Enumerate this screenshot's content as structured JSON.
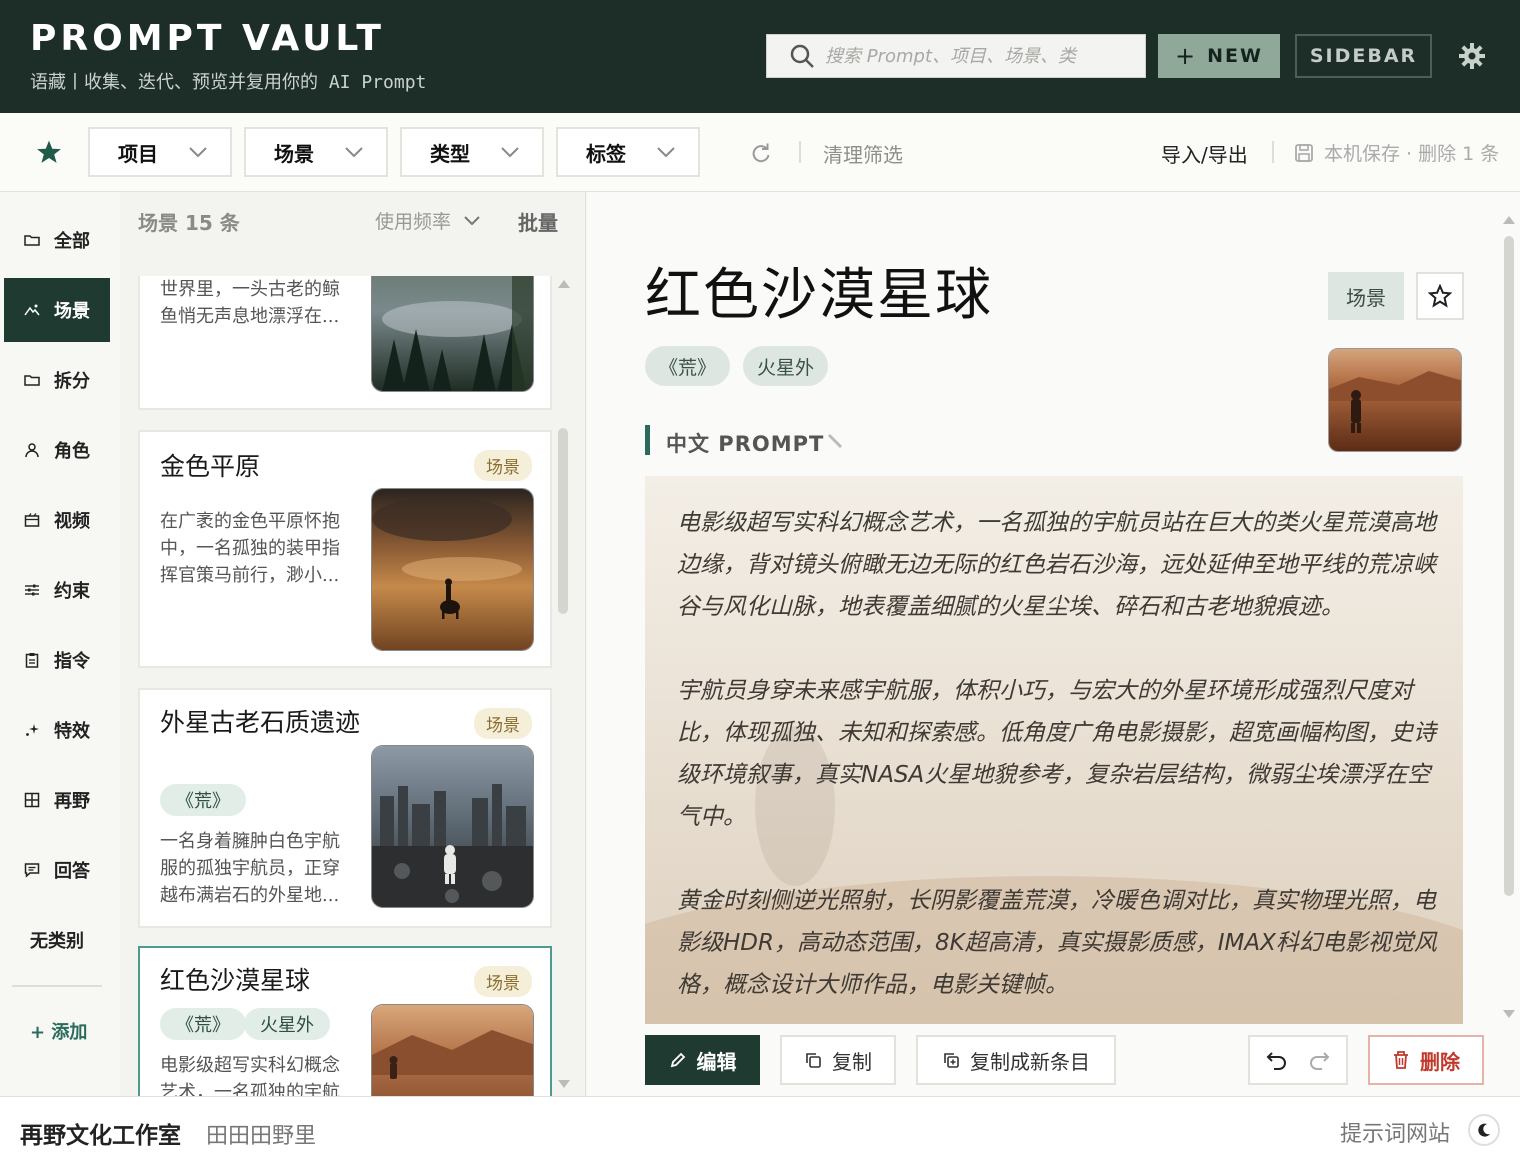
{
  "header": {
    "brand": "PROMPT VAULT",
    "tagline": "语藏丨收集、迭代、预览并复用你的 AI Prompt",
    "search_placeholder": "搜索 Prompt、项目、场景、类",
    "new_label": "NEW",
    "sidebar_label": "SIDEBAR"
  },
  "filters": {
    "dropdowns": [
      "项目",
      "场景",
      "类型",
      "标签"
    ],
    "clear": "清理筛选",
    "import_export": "导入/导出",
    "save_status": "本机保存 · 删除 1 条"
  },
  "nav": {
    "items": [
      {
        "label": "全部",
        "icon": "folder-icon"
      },
      {
        "label": "场景",
        "icon": "landscape-icon"
      },
      {
        "label": "拆分",
        "icon": "folder-icon"
      },
      {
        "label": "角色",
        "icon": "person-icon"
      },
      {
        "label": "视频",
        "icon": "video-icon"
      },
      {
        "label": "约束",
        "icon": "sliders-icon"
      },
      {
        "label": "指令",
        "icon": "clipboard-icon"
      },
      {
        "label": "特效",
        "icon": "sparkle-icon"
      },
      {
        "label": "再野",
        "icon": "grid-icon"
      },
      {
        "label": "回答",
        "icon": "message-icon"
      },
      {
        "label": "无类别",
        "icon": ""
      }
    ],
    "add": "+ 添加",
    "active_index": 1
  },
  "list": {
    "title": "场景 15 条",
    "sort": "使用频率",
    "batch": "批量",
    "cards": [
      {
        "title": "",
        "badge": "",
        "tags": [],
        "desc": "世界里，一头古老的鲸鱼悄无声息地漂浮在..."
      },
      {
        "title": "金色平原",
        "badge": "场景",
        "tags": [],
        "desc": "在广袤的金色平原怀抱中，一名孤独的装甲指挥官策马前行，渺小..."
      },
      {
        "title": "外星古老石质遗迹",
        "badge": "场景",
        "tags": [
          "《荒》"
        ],
        "desc": "一名身着臃肿白色宇航服的孤独宇航员，正穿越布满岩石的外星地..."
      },
      {
        "title": "红色沙漠星球",
        "badge": "场景",
        "tags": [
          "《荒》",
          "火星外"
        ],
        "desc": "电影级超写实科幻概念艺术，一名孤独的宇航"
      }
    ]
  },
  "detail": {
    "title": "红色沙漠星球",
    "type": "场景",
    "tags": [
      "《荒》",
      "火星外"
    ],
    "section": "中文 PROMPT",
    "prompt": "电影级超写实科幻概念艺术，一名孤独的宇航员站在巨大的类火星荒漠高地边缘，背对镜头俯瞰无边无际的红色岩石沙海，远处延伸至地平线的荒凉峡谷与风化山脉，地表覆盖细腻的火星尘埃、碎石和古老地貌痕迹。\n\n宇航员身穿未来感宇航服，体积小巧，与宏大的外星环境形成强烈尺度对比，体现孤独、未知和探索感。低角度广角电影摄影，超宽画幅构图，史诗级环境叙事，真实NASA火星地貌参考，复杂岩层结构，微弱尘埃漂浮在空气中。\n\n黄金时刻侧逆光照射，长阴影覆盖荒漠，冷暖色调对比，真实物理光照，电影级HDR，高动态范围，8K超高清，真实摄影质感，IMAX科幻电影视觉风格，概念设计大师作品，电影关键帧。",
    "actions": {
      "edit": "编辑",
      "copy": "复制",
      "dup": "复制成新条目",
      "del": "删除"
    }
  },
  "footer": {
    "brand": "再野文化工作室",
    "sub": "田田田野里",
    "link": "提示词网站"
  },
  "colors": {
    "header_bg": "#1d2d27",
    "accent": "#1f3a30",
    "teal": "#2a6c5c",
    "danger": "#c0392b"
  }
}
